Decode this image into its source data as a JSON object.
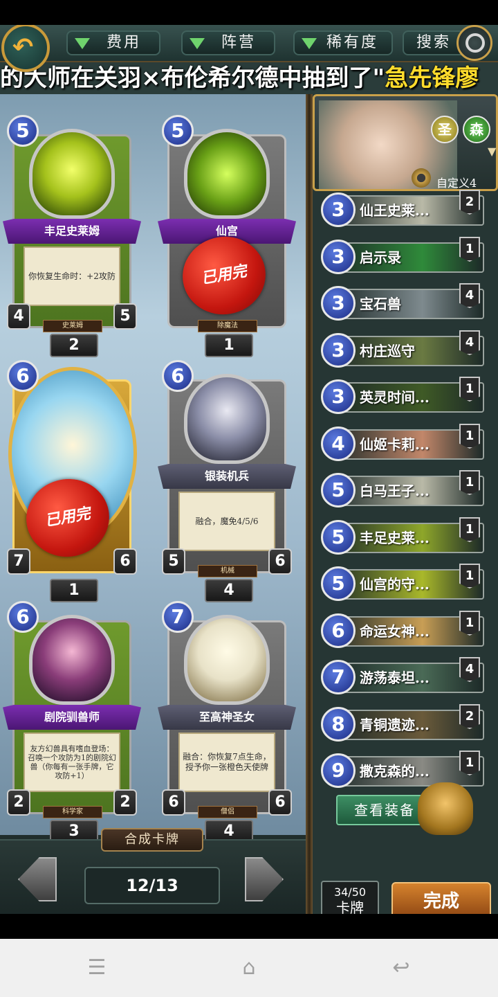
{
  "filters": {
    "cost": "费用",
    "faction": "阵营",
    "rarity": "稀有度",
    "search": "搜索"
  },
  "ticker": {
    "text": "的大师在关羽×布伦希尔德中抽到了\"",
    "highlight": "急先锋廖"
  },
  "cards": [
    {
      "cost": "5",
      "name": "丰足史莱姆",
      "desc": "你恢复生命时：+2攻防",
      "atk": "4",
      "hp": "5",
      "tribe": "史莱姆",
      "count": "2",
      "used": ""
    },
    {
      "cost": "5",
      "name": "仙宫",
      "desc": "",
      "atk": "",
      "hp": "",
      "tribe": "除魔法",
      "count": "1",
      "used": "已用完"
    },
    {
      "cost": "6",
      "name": "",
      "desc": "",
      "atk": "7",
      "hp": "6",
      "tribe": "",
      "count": "1",
      "used": "已用完"
    },
    {
      "cost": "6",
      "name": "银装机兵",
      "desc": "融合，魔免4/5/6",
      "atk": "5",
      "hp": "6",
      "tribe": "机械",
      "count": "4",
      "used": ""
    },
    {
      "cost": "6",
      "name": "剧院驯兽师",
      "desc": "友方幻兽具有嗜血登场：召唤一个攻防为1的剧院幻兽（你每有一张手牌，它攻防+1）",
      "atk": "2",
      "hp": "2",
      "tribe": "科学家",
      "count": "3",
      "used": ""
    },
    {
      "cost": "7",
      "name": "至高神圣女",
      "desc": "融合：你恢复7点生命，授予你一张橙色天使牌",
      "atk": "6",
      "hp": "6",
      "tribe": "僧侣",
      "count": "4",
      "used": ""
    }
  ],
  "craft_label": "合成卡牌",
  "page": "12/13",
  "deck": {
    "factions": [
      "圣",
      "森"
    ],
    "name": "自定义4",
    "rows": [
      {
        "cost": "3",
        "name": "仙王史莱...",
        "count": "2",
        "color": "#b9b9a7"
      },
      {
        "cost": "3",
        "name": "启示录",
        "count": "1",
        "color": "#2f8a3a"
      },
      {
        "cost": "3",
        "name": "宝石兽",
        "count": "4",
        "color": "#7e8a8e"
      },
      {
        "cost": "3",
        "name": "村庄巡守",
        "count": "4",
        "color": "#6a7a42"
      },
      {
        "cost": "3",
        "name": "英灵时间...",
        "count": "1",
        "color": "#3f5a26"
      },
      {
        "cost": "4",
        "name": "仙姬卡莉...",
        "count": "1",
        "color": "#c2876a"
      },
      {
        "cost": "5",
        "name": "白马王子...",
        "count": "1",
        "color": "#b9b9a7"
      },
      {
        "cost": "5",
        "name": "丰足史莱...",
        "count": "1",
        "color": "#8ea62a"
      },
      {
        "cost": "5",
        "name": "仙宫的守...",
        "count": "1",
        "color": "#a9b82a"
      },
      {
        "cost": "6",
        "name": "命运女神...",
        "count": "1",
        "color": "#c89e55"
      },
      {
        "cost": "7",
        "name": "游荡泰坦...",
        "count": "4",
        "color": "#4a6a56"
      },
      {
        "cost": "8",
        "name": "青铜遗迹...",
        "count": "2",
        "color": "#6a5a3a"
      },
      {
        "cost": "9",
        "name": "撒克森的...",
        "count": "1",
        "color": "#8a8a84"
      }
    ],
    "equip_label": "查看装备",
    "count_top": "34/50",
    "count_bottom": "卡牌",
    "done": "完成"
  },
  "colors": {
    "accent_gold": "#c9a04a",
    "cost_blue": "#1c2c84",
    "done_orange": "#d6832d"
  }
}
